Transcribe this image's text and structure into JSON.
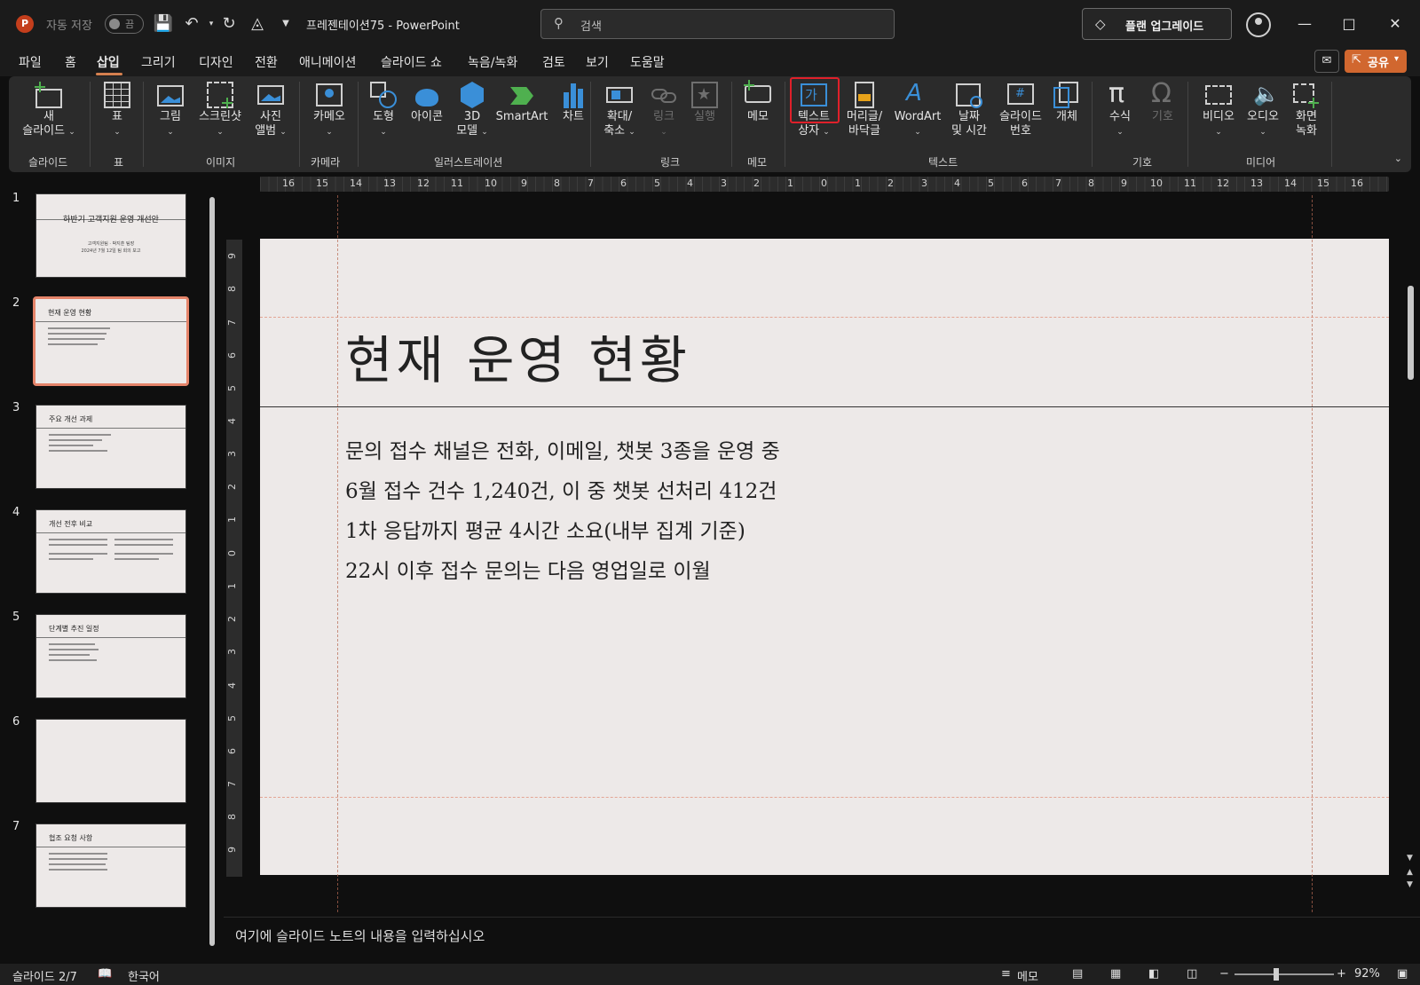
{
  "titlebar": {
    "autosave_label": "자동 저장",
    "autosave_state": "끔",
    "document_title": "프레젠테이션75  -  PowerPoint",
    "search_placeholder": "검색",
    "upgrade_label": "플랜 업그레이드"
  },
  "menu": {
    "tabs": [
      "파일",
      "홈",
      "삽입",
      "그리기",
      "디자인",
      "전환",
      "애니메이션",
      "슬라이드 쇼",
      "녹음/녹화",
      "검토",
      "보기",
      "도움말"
    ],
    "active_tab": "삽입",
    "share_label": "공유"
  },
  "ribbon": {
    "groups": {
      "slides": "슬라이드",
      "table": "표",
      "images": "이미지",
      "camera": "카메라",
      "illustrations": "일러스트레이션",
      "links": "링크",
      "comments": "메모",
      "text": "텍스트",
      "symbols": "기호",
      "media": "미디어"
    },
    "buttons": {
      "new_slide_1": "새",
      "new_slide_2": "슬라이드",
      "table": "표",
      "pictures": "그림",
      "screenshot": "스크린샷",
      "photo_album_1": "사진",
      "photo_album_2": "앨범",
      "cameo": "카메오",
      "shapes": "도형",
      "icons": "아이콘",
      "model3d_1": "3D",
      "model3d_2": "모델",
      "smartart": "SmartArt",
      "chart": "차트",
      "zoom_1": "확대/",
      "zoom_2": "축소",
      "link": "링크",
      "action": "실행",
      "comment": "메모",
      "textbox_1": "텍스트",
      "textbox_2": "상자",
      "textbox_glyph": "가",
      "header_footer_1": "머리글/",
      "header_footer_2": "바닥글",
      "wordart": "WordArt",
      "datetime_1": "날짜",
      "datetime_2": "및 시간",
      "slide_number_1": "슬라이드",
      "slide_number_2": "번호",
      "object": "개체",
      "equation": "수식",
      "symbol": "기호",
      "video": "비디오",
      "audio": "오디오",
      "screen_recording_1": "화면",
      "screen_recording_2": "녹화"
    }
  },
  "thumbnails": [
    {
      "number": "1",
      "title": "하반기 고객지원 운영 개선안",
      "sub1": "고객지원팀 · 박지훈 팀장",
      "sub2": "2024년 7월 12일 팀 회의 보고"
    },
    {
      "number": "2",
      "title": "현재 운영 현황"
    },
    {
      "number": "3",
      "title": "주요 개선 과제"
    },
    {
      "number": "4",
      "title": "개선 전후 비교"
    },
    {
      "number": "5",
      "title": "단계별 추진 일정"
    },
    {
      "number": "6",
      "title": ""
    },
    {
      "number": "7",
      "title": "협조 요청 사항"
    }
  ],
  "ruler": {
    "horizontal": [
      "16",
      "15",
      "14",
      "13",
      "12",
      "11",
      "10",
      "9",
      "8",
      "7",
      "6",
      "5",
      "4",
      "3",
      "2",
      "1",
      "0",
      "1",
      "2",
      "3",
      "4",
      "5",
      "6",
      "7",
      "8",
      "9",
      "10",
      "11",
      "12",
      "13",
      "14",
      "15",
      "16"
    ],
    "vertical": [
      "9",
      "8",
      "7",
      "6",
      "5",
      "4",
      "3",
      "2",
      "1",
      "0",
      "1",
      "2",
      "3",
      "4",
      "5",
      "6",
      "7",
      "8",
      "9"
    ]
  },
  "slide": {
    "title": "현재 운영 현황",
    "bullets": [
      "문의 접수 채널은 전화, 이메일, 챗봇 3종을 운영 중",
      "6월 접수 건수 1,240건, 이 중 챗봇 선처리 412건",
      "1차 응답까지 평균 4시간 소요(내부 집계 기준)",
      "22시 이후 접수 문의는 다음 영업일로 이월"
    ]
  },
  "notes": {
    "placeholder": "여기에 슬라이드 노트의 내용을 입력하십시오"
  },
  "statusbar": {
    "slide_indicator": "슬라이드 2/7",
    "language": "한국어",
    "notes_label": "메모",
    "zoom": "92%",
    "zoom_level": 0.92
  },
  "colors": {
    "accent": "#d5804f",
    "share": "#d1672f",
    "slide_bg": "#ede9e8",
    "highlight": "#e0202a"
  }
}
